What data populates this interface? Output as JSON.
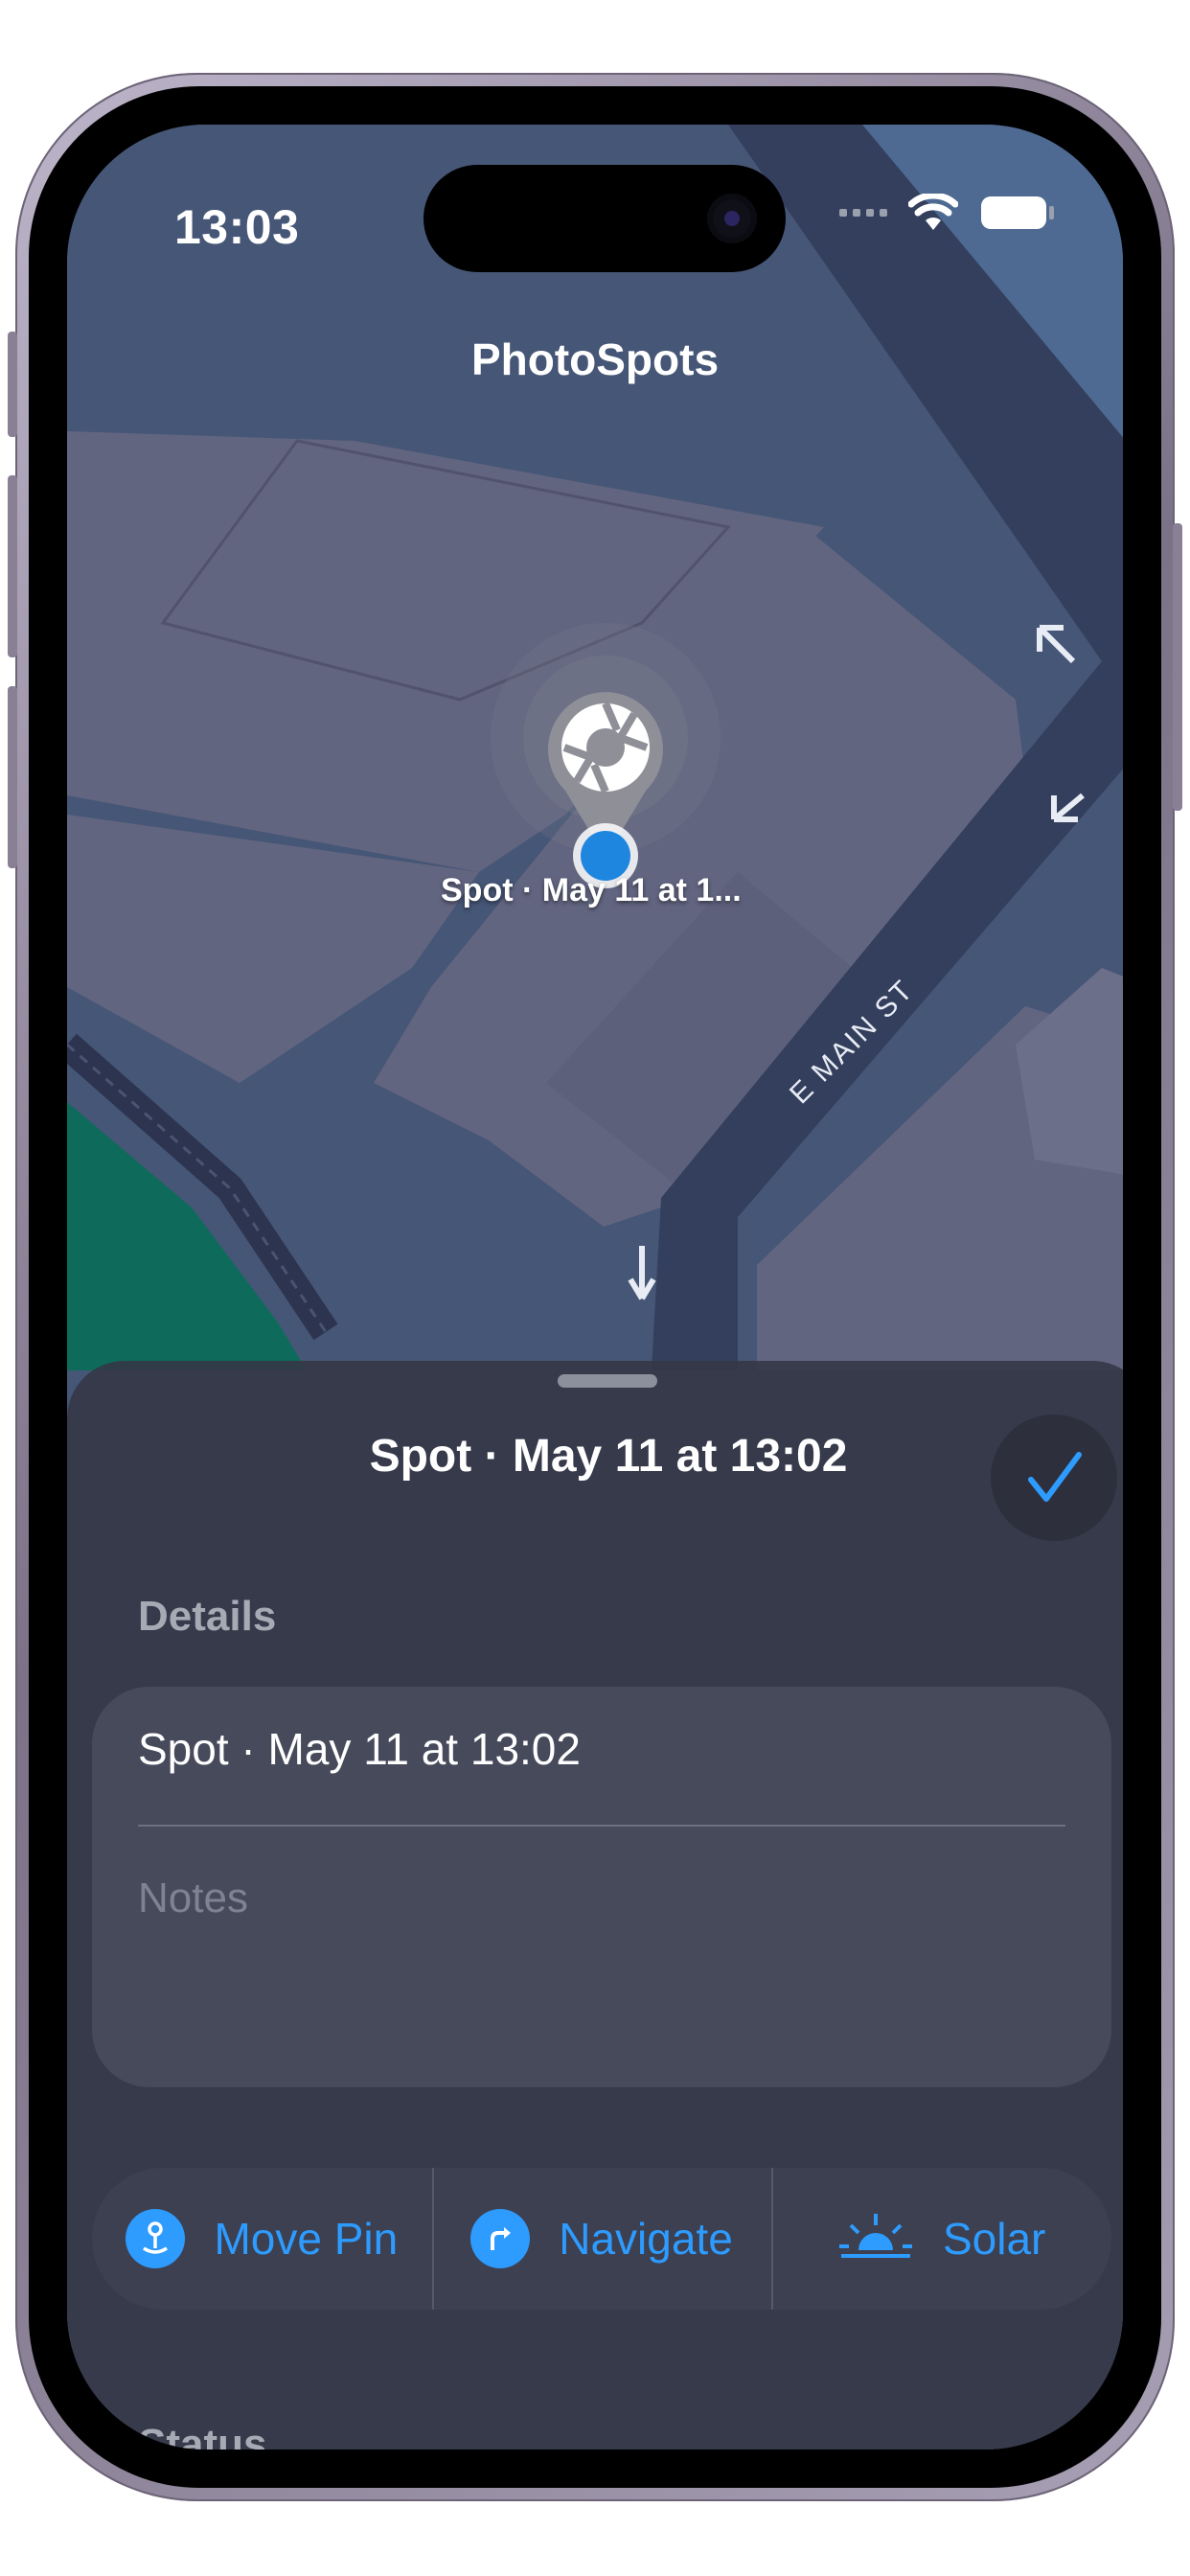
{
  "status_bar": {
    "time": "13:03"
  },
  "app": {
    "title": "PhotoSpots"
  },
  "map": {
    "pin_label": "Spot · May 11 at 1...",
    "street_label": "E MAIN ST"
  },
  "sheet": {
    "title": "Spot · May 11 at 13:02",
    "details_label": "Details",
    "spot_name": "Spot · May 11 at 13:02",
    "notes_placeholder": "Notes",
    "actions": [
      {
        "label": "Move Pin",
        "icon": "move-pin-icon"
      },
      {
        "label": "Navigate",
        "icon": "navigate-icon"
      },
      {
        "label": "Solar",
        "icon": "sunrise-icon"
      }
    ],
    "status_label": "Status"
  },
  "colors": {
    "accent": "#2e9bff",
    "map_block": "#62657f",
    "map_road": "#3a4a69",
    "park": "#0e6b5b"
  }
}
